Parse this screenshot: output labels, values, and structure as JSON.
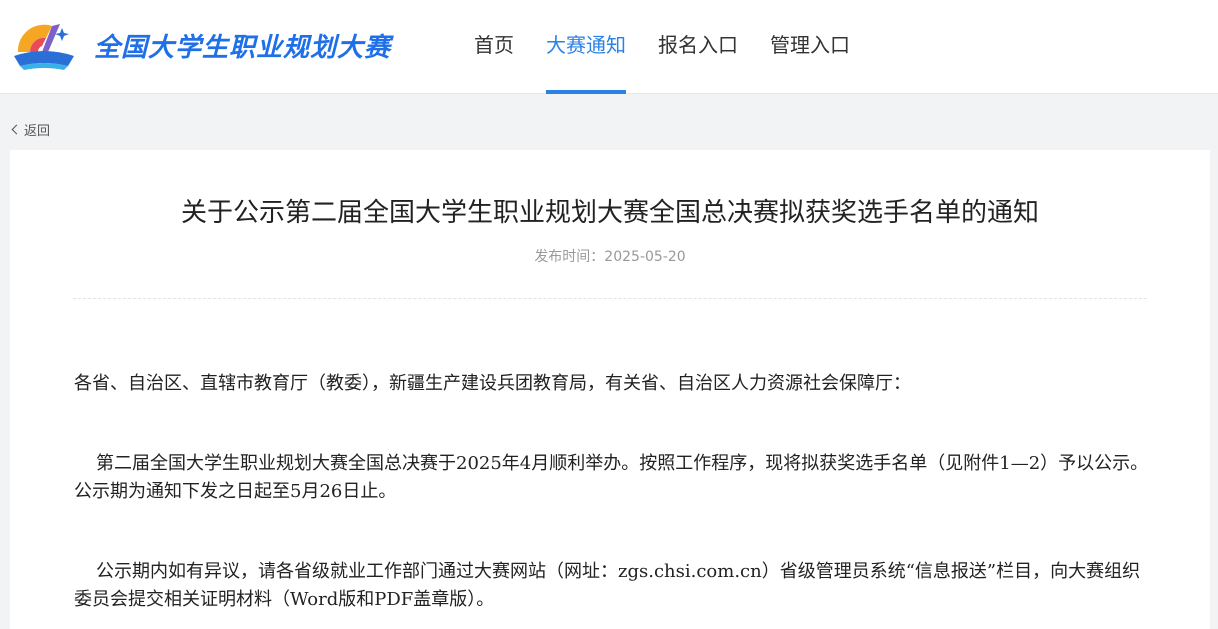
{
  "brand": {
    "name": "全国大学生职业规划大赛"
  },
  "nav": {
    "items": [
      {
        "label": "首页",
        "active": false
      },
      {
        "label": "大赛通知",
        "active": true
      },
      {
        "label": "报名入口",
        "active": false
      },
      {
        "label": "管理入口",
        "active": false
      }
    ]
  },
  "back": {
    "label": "返回",
    "icon": "chevron-left-icon"
  },
  "article": {
    "title": "关于公示第二届全国大学生职业规划大赛全国总决赛拟获奖选手名单的通知",
    "publish_time": "发布时间：2025-05-20",
    "paragraphs": [
      "各省、自治区、直辖市教育厅（教委），新疆生产建设兵团教育局，有关省、自治区人力资源社会保障厅：",
      "第二届全国大学生职业规划大赛全国总决赛于2025年4月顺利举办。按照工作程序，现将拟获奖选手名单（见附件1—2）予以公示。公示期为通知下发之日起至5月26日止。",
      "公示期内如有异议，请各省级就业工作部门通过大赛网站（网址：zgs.chsi.com.cn）省级管理员系统“信息报送”栏目，向大赛组织委员会提交相关证明材料（Word版和PDF盖章版）。"
    ]
  },
  "colors": {
    "accent": "#2a82e4",
    "brand": "#1e6fe8"
  }
}
